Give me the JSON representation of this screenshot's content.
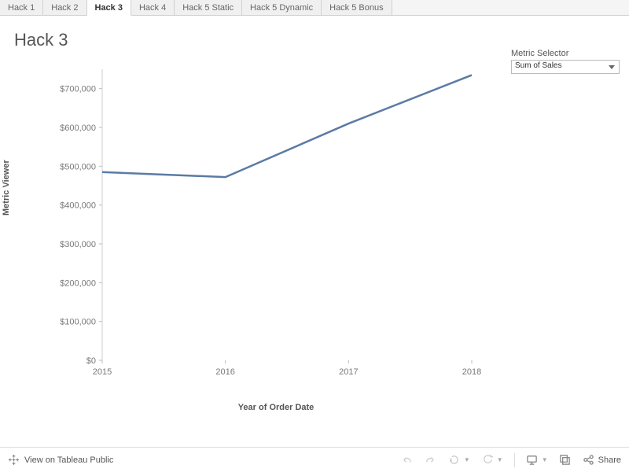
{
  "tabs": [
    {
      "label": "Hack 1",
      "active": false
    },
    {
      "label": "Hack 2",
      "active": false
    },
    {
      "label": "Hack 3",
      "active": true
    },
    {
      "label": "Hack 4",
      "active": false
    },
    {
      "label": "Hack 5 Static",
      "active": false
    },
    {
      "label": "Hack 5 Dynamic",
      "active": false
    },
    {
      "label": "Hack 5 Bonus",
      "active": false
    }
  ],
  "title": "Hack 3",
  "selector": {
    "label": "Metric Selector",
    "value": "Sum of Sales"
  },
  "toolbar": {
    "view_label": "View on Tableau Public",
    "share_label": "Share"
  },
  "chart_data": {
    "type": "line",
    "ylabel": "Metric Viewer",
    "xlabel": "Year of Order Date",
    "x": [
      2015,
      2016,
      2017,
      2018
    ],
    "series": [
      {
        "name": "Sum of Sales",
        "values": [
          485000,
          472000,
          610000,
          735000
        ]
      }
    ],
    "ylim": [
      0,
      750000
    ],
    "yticks": [
      0,
      100000,
      200000,
      300000,
      400000,
      500000,
      600000,
      700000
    ],
    "ytick_labels": [
      "$0",
      "$100,000",
      "$200,000",
      "$300,000",
      "$400,000",
      "$500,000",
      "$600,000",
      "$700,000"
    ]
  }
}
